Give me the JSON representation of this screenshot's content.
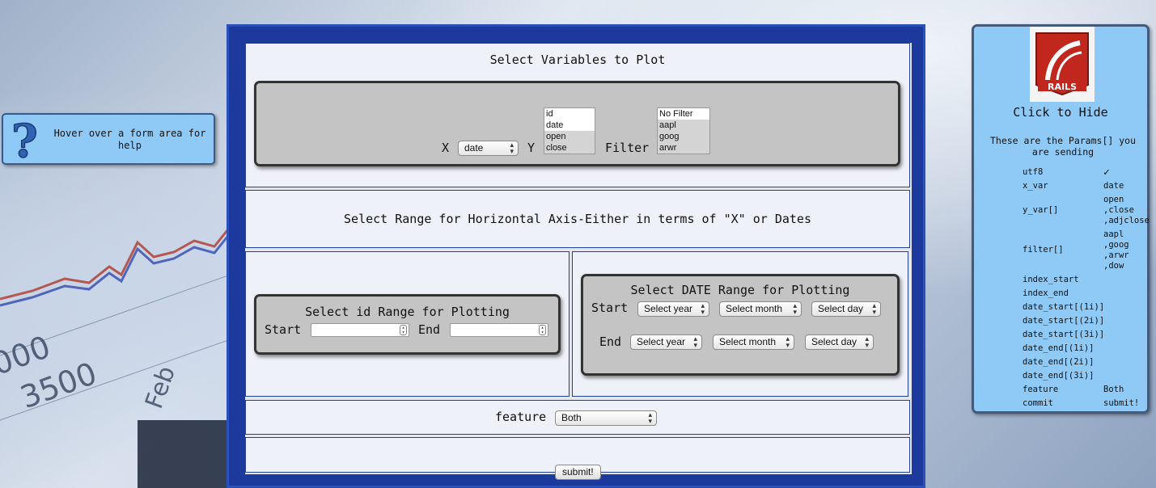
{
  "help": {
    "text": "Hover over a form area for help",
    "icon": "question-mark-icon"
  },
  "variables": {
    "title": "Select Variables to Plot",
    "x_label": "X",
    "x_value": "date",
    "y_label": "Y",
    "y_options": [
      "id",
      "date",
      "open",
      "close"
    ],
    "filter_label": "Filter",
    "filter_options": [
      "No Filter",
      "aapl",
      "goog",
      "arwr"
    ]
  },
  "range": {
    "title": "Select Range for Horizontal Axis-Either in terms of \"X\" or Dates"
  },
  "id_range": {
    "title": "Select id Range for Plotting",
    "start_label": "Start",
    "end_label": "End"
  },
  "date_range": {
    "title": "Select DATE Range for Plotting",
    "start_label": "Start",
    "end_label": "End",
    "year_placeholder": "Select year",
    "month_placeholder": "Select month",
    "day_placeholder": "Select day"
  },
  "feature": {
    "label": "feature",
    "value": "Both"
  },
  "submit": {
    "label": "submit!"
  },
  "params_panel": {
    "logo_text": "RAILS",
    "click_hide": "Click to Hide",
    "description": "These are the Params[] you are sending",
    "rows": [
      {
        "key": "utf8",
        "value": "✓"
      },
      {
        "key": "x_var",
        "value": "date"
      },
      {
        "key": "y_var[]",
        "value": "open\n,close\n,adjclose"
      },
      {
        "key": "filter[]",
        "value": "aapl\n,goog\n,arwr\n,dow"
      },
      {
        "key": "index_start",
        "value": ""
      },
      {
        "key": "index_end",
        "value": ""
      },
      {
        "key": "date_start[(1i)]",
        "value": ""
      },
      {
        "key": "date_start[(2i)]",
        "value": ""
      },
      {
        "key": "date_start[(3i)]",
        "value": ""
      },
      {
        "key": "date_end[(1i)]",
        "value": ""
      },
      {
        "key": "date_end[(2i)]",
        "value": ""
      },
      {
        "key": "date_end[(3i)]",
        "value": ""
      },
      {
        "key": "feature",
        "value": "Both"
      },
      {
        "key": "commit",
        "value": "submit!"
      }
    ]
  },
  "background": {
    "axis_labels": [
      "3500",
      "Feb"
    ],
    "partial_label": "000"
  },
  "colors": {
    "frame": "#1c3a9e",
    "panel_blue": "#8fcaf6",
    "grey_panel": "#c4c4c4"
  }
}
